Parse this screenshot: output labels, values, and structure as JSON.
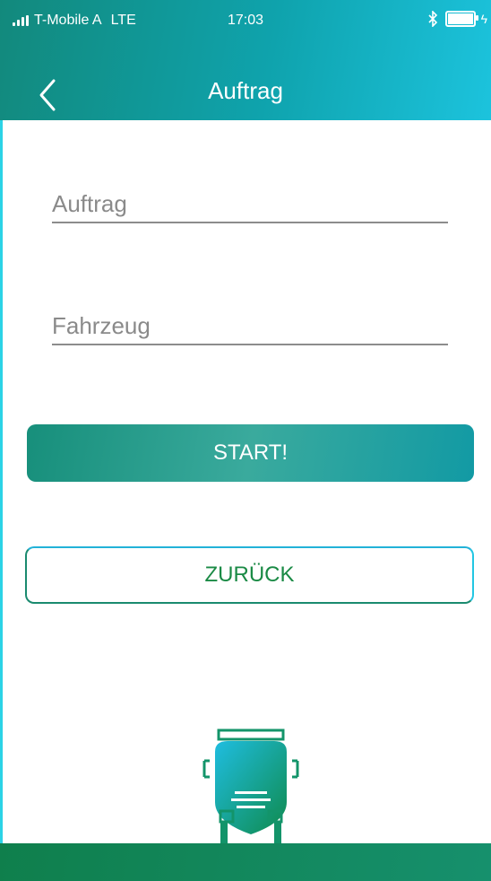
{
  "status_bar": {
    "carrier": "T-Mobile A",
    "network": "LTE",
    "time": "17:03",
    "bluetooth_icon": "bluetooth-icon",
    "battery_icon": "battery-icon"
  },
  "header": {
    "title": "Auftrag",
    "back_icon": "chevron-left-icon"
  },
  "form": {
    "auftrag_placeholder": "Auftrag",
    "auftrag_value": "",
    "fahrzeug_placeholder": "Fahrzeug",
    "fahrzeug_value": ""
  },
  "buttons": {
    "start_label": "START!",
    "back_label": "ZURÜCK"
  },
  "colors": {
    "accent_teal": "#12897c",
    "accent_cyan": "#1cc3dd",
    "button_green_text": "#1a8a45",
    "footer_green": "#0f7f4c"
  }
}
